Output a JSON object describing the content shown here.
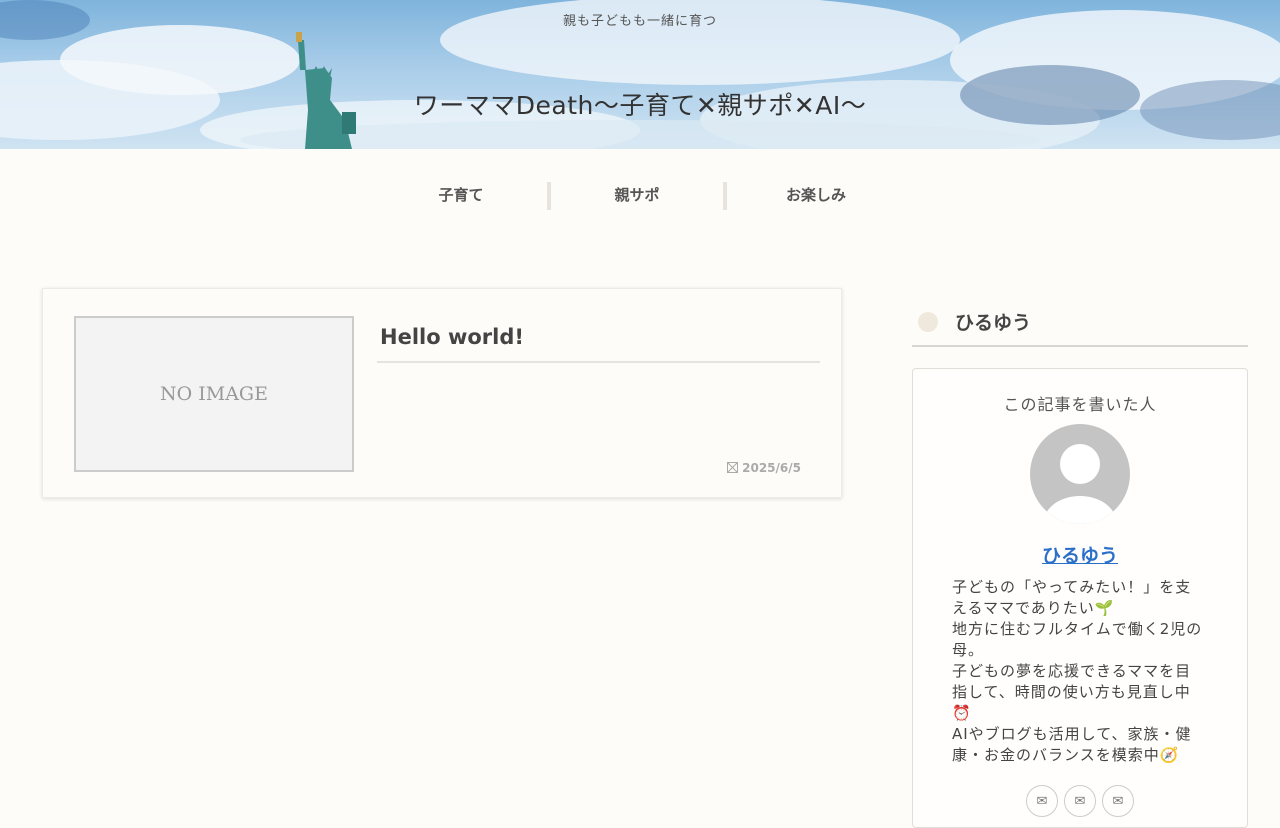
{
  "header": {
    "tagline": "親も子どもも一緒に育つ",
    "site_title": "ワーママDeath〜子育て✕親サポ✕AI〜"
  },
  "nav": {
    "items": [
      {
        "label": "子育て"
      },
      {
        "label": "親サポ"
      },
      {
        "label": "お楽しみ"
      }
    ]
  },
  "post": {
    "thumbnail_text": "NO IMAGE",
    "title": "Hello world!",
    "date": "2025/6/5",
    "date_icon": "calendar-icon"
  },
  "sidebar": {
    "heading": "ひるゆう",
    "profile": {
      "caption": "この記事を書いた人",
      "author_name": "ひるゆう",
      "bio_lines": [
        "子どもの「やってみたい！」を支",
        "えるママでありたい🌱",
        "地方に住むフルタイムで働く2児の",
        "母。",
        "子どもの夢を応援できるママを目",
        "指して、時間の使い方も見直し中",
        "⏰",
        "AIやブログも活用して、家族・健",
        "康・お金のバランスを模索中🧭"
      ],
      "social_icons": [
        "mail-icon",
        "mail-icon",
        "mail-icon"
      ]
    }
  },
  "colors": {
    "background": "#fefcf9",
    "link": "#2a6fc9",
    "sky": "#7fb4dc"
  }
}
